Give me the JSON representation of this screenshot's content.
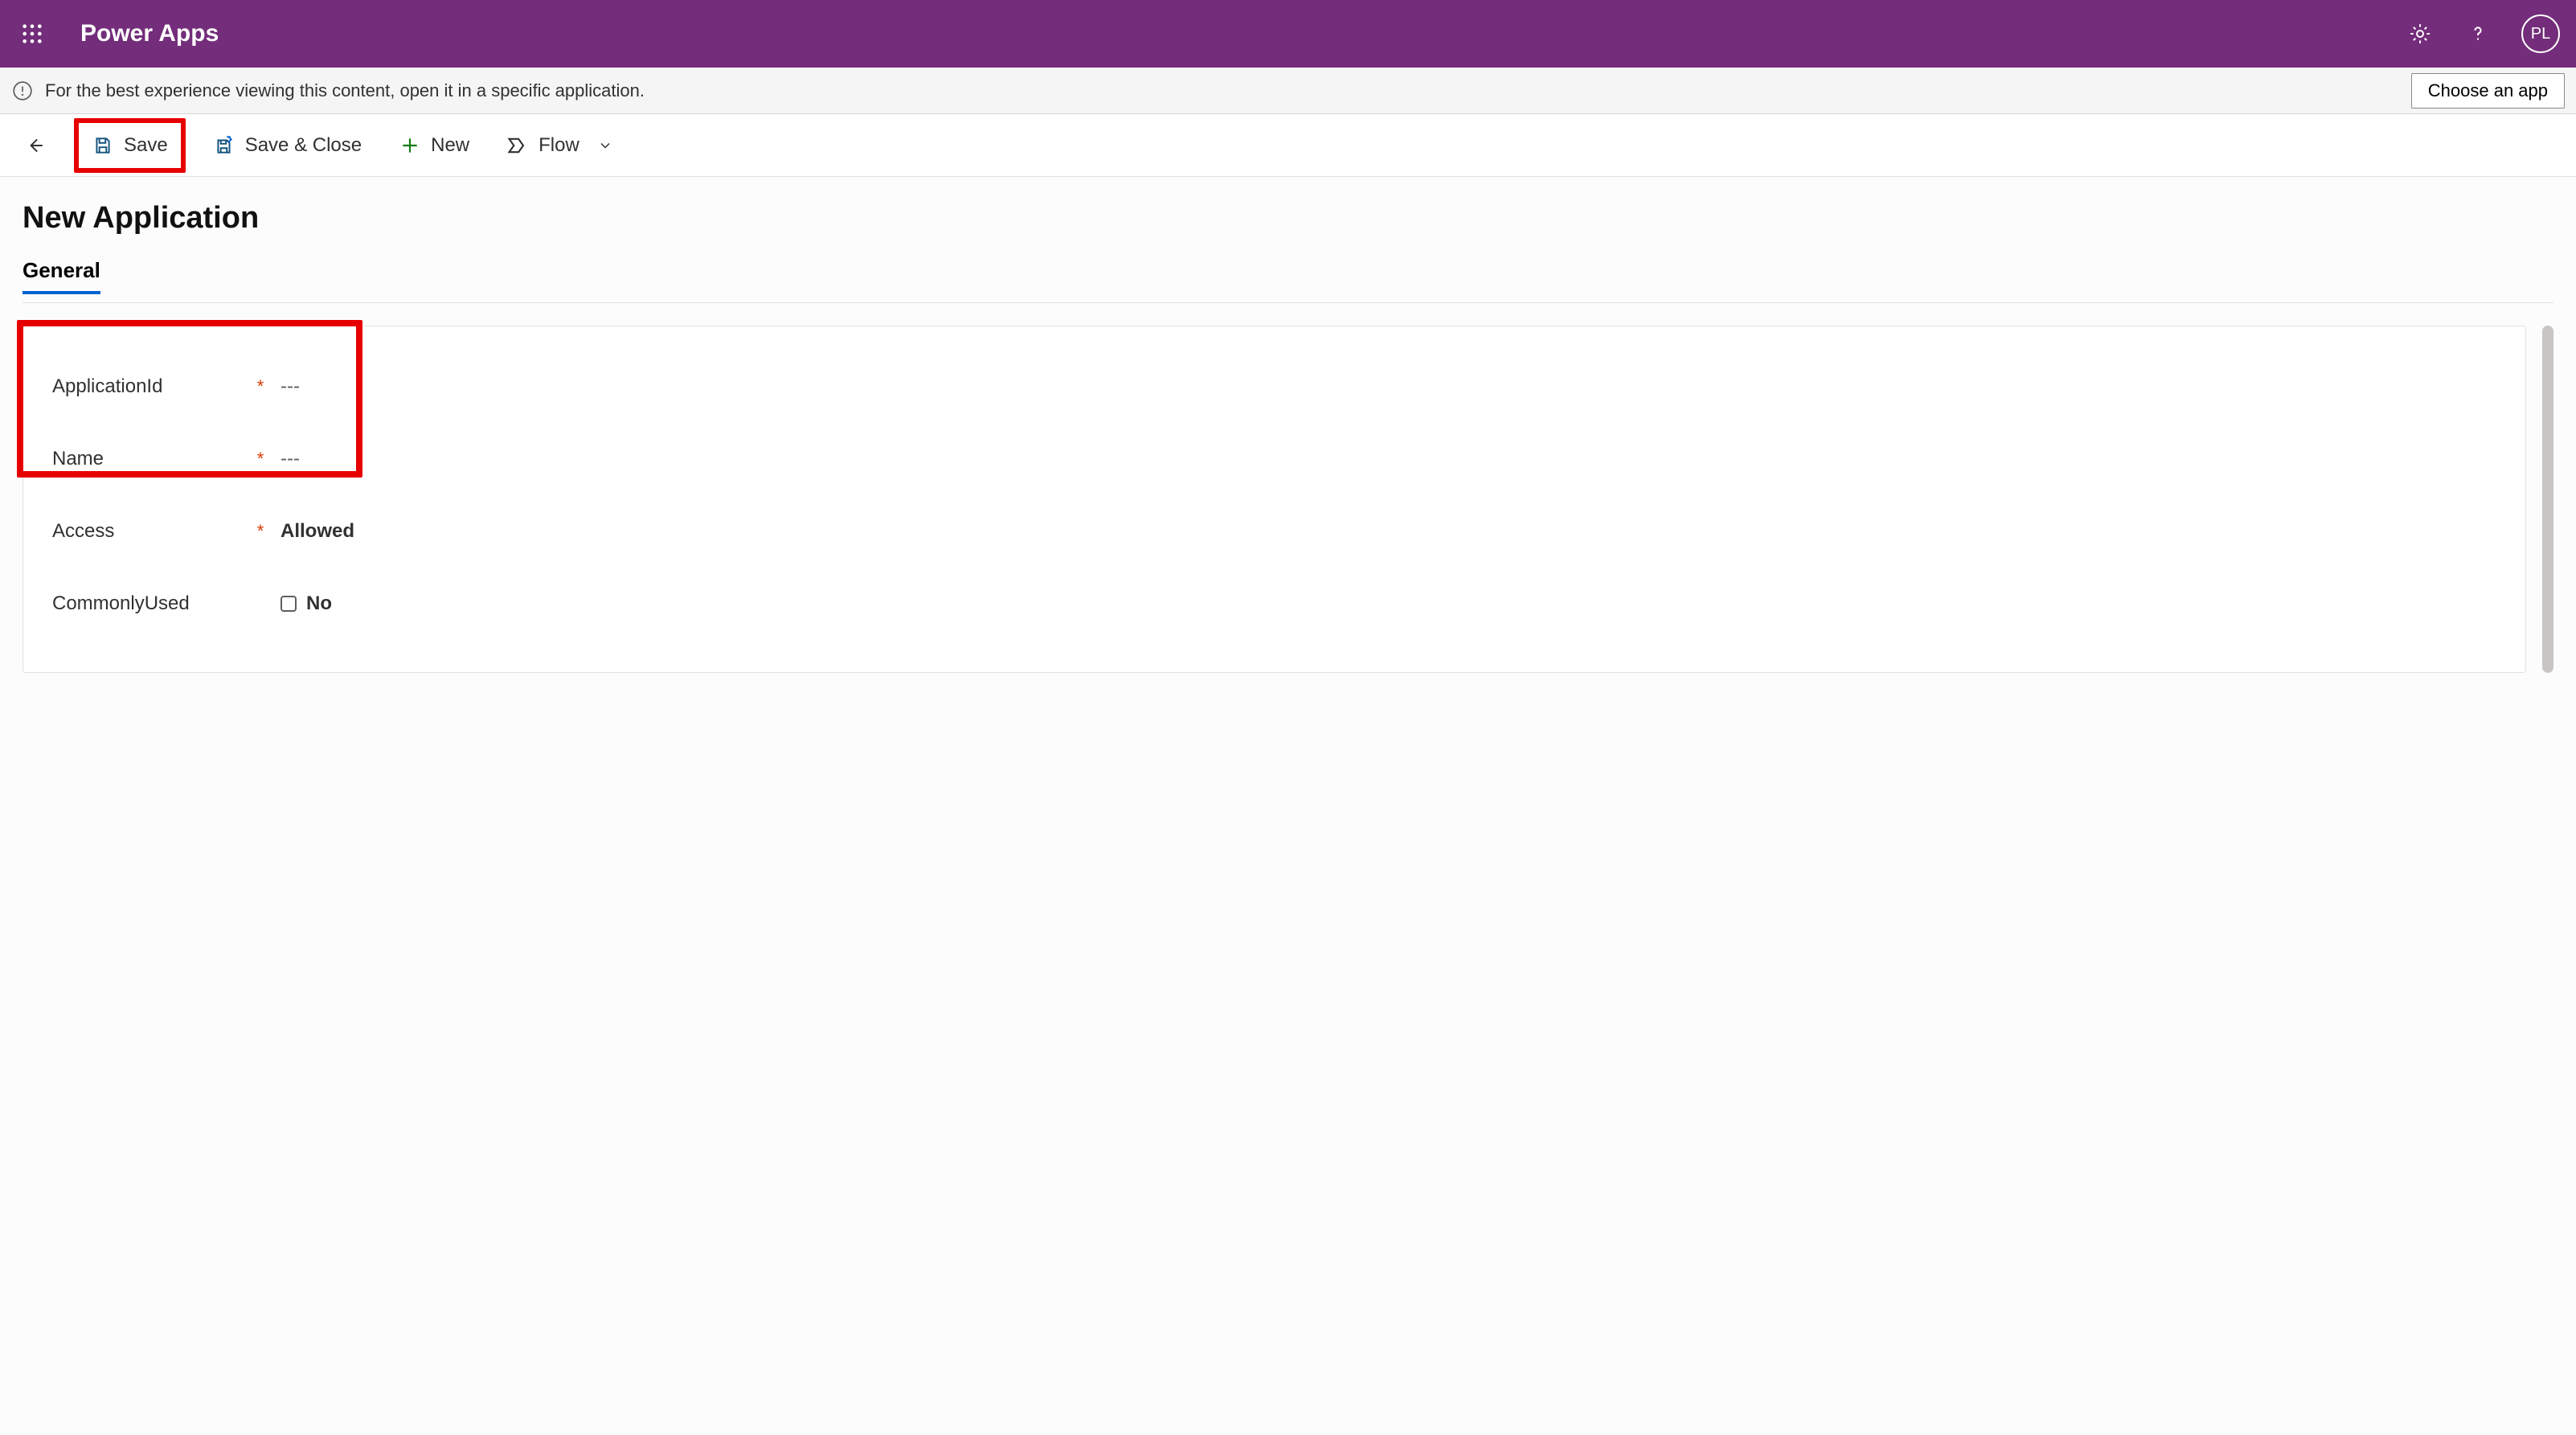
{
  "header": {
    "app_title": "Power Apps",
    "user_initials": "PL"
  },
  "info_bar": {
    "message": "For the best experience viewing this content, open it in a specific application.",
    "choose_app_label": "Choose an app"
  },
  "toolbar": {
    "save_label": "Save",
    "save_close_label": "Save & Close",
    "new_label": "New",
    "flow_label": "Flow"
  },
  "page": {
    "title": "New Application",
    "tab_general": "General"
  },
  "form": {
    "fields": {
      "application_id": {
        "label": "ApplicationId",
        "required": true,
        "value": "---"
      },
      "name": {
        "label": "Name",
        "required": true,
        "value": "---"
      },
      "access": {
        "label": "Access",
        "required": true,
        "value": "Allowed"
      },
      "commonly_used": {
        "label": "CommonlyUsed",
        "required": false,
        "value": "No",
        "checked": false
      }
    }
  },
  "required_marker": "*"
}
